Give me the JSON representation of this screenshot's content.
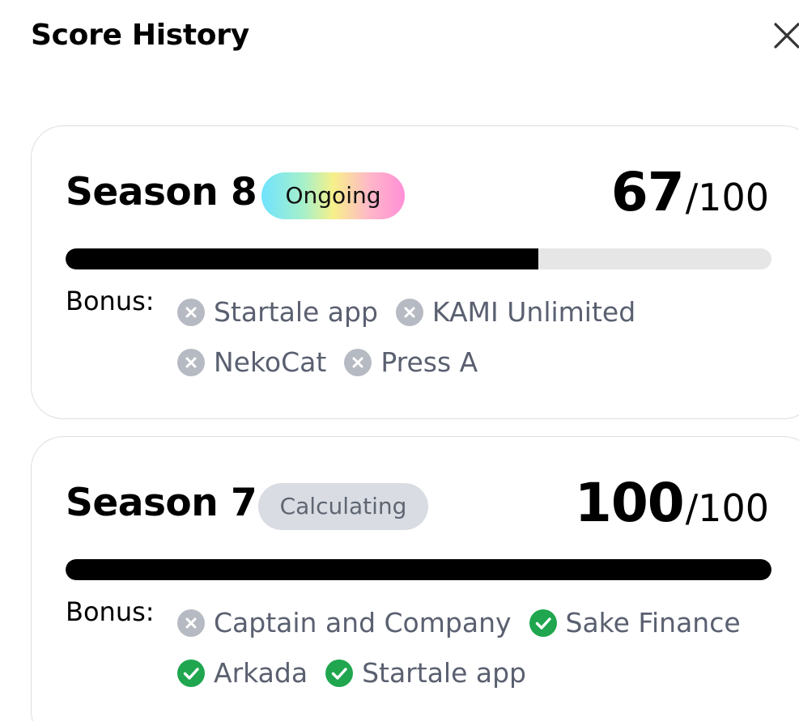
{
  "header": {
    "title": "Score History"
  },
  "colors": {
    "check": "#1fa64f",
    "cross": "#b6bac2",
    "progress_fill": "#000000",
    "progress_track": "#e6e6e6"
  },
  "seasons": [
    {
      "title": "Season 8",
      "status": "Ongoing",
      "score": "67",
      "total": "/100",
      "progress": 0.67,
      "bonus_label": "Bonus:",
      "bonuses": [
        {
          "name": "Startale app",
          "completed": false,
          "icon": "cross-circle-icon"
        },
        {
          "name": "KAMI Unlimited",
          "completed": false,
          "icon": "cross-circle-icon"
        },
        {
          "name": "NekoCat",
          "completed": false,
          "icon": "cross-circle-icon"
        },
        {
          "name": "Press A",
          "completed": false,
          "icon": "cross-circle-icon"
        }
      ]
    },
    {
      "title": "Season 7",
      "status": "Calculating",
      "score": "100",
      "total": "/100",
      "progress": 1.0,
      "bonus_label": "Bonus:",
      "bonuses": [
        {
          "name": "Captain and Company",
          "completed": false,
          "icon": "cross-circle-icon"
        },
        {
          "name": "Sake Finance",
          "completed": true,
          "icon": "check-circle-icon"
        },
        {
          "name": "Arkada",
          "completed": true,
          "icon": "check-circle-icon"
        },
        {
          "name": "Startale app",
          "completed": true,
          "icon": "check-circle-icon"
        }
      ]
    }
  ]
}
